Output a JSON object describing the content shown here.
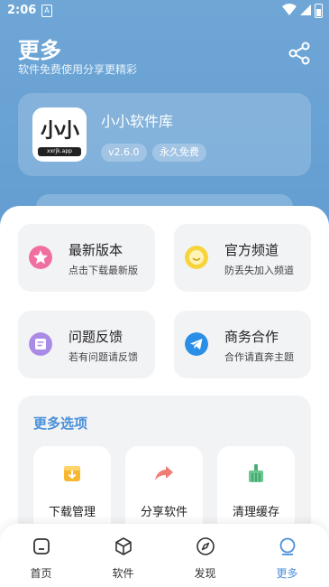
{
  "status_bar": {
    "time": "2:06",
    "sim_letter": "A"
  },
  "header": {
    "title": "更多",
    "subtitle": "软件免费使用分享更精彩"
  },
  "app": {
    "name": "小小软件库",
    "logo_text": "小小",
    "logo_domain": "xxrjk.app",
    "version": "v2.6.0",
    "license": "永久免费"
  },
  "features": [
    {
      "title": "最新版本",
      "desc": "点击下载最新版",
      "icon": "star-icon",
      "color": "#f06ea0"
    },
    {
      "title": "官方频道",
      "desc": "防丢失加入频道",
      "icon": "smile-icon",
      "color": "#f7d43b"
    },
    {
      "title": "问题反馈",
      "desc": "若有问题请反馈",
      "icon": "feedback-icon",
      "color": "#a98be6"
    },
    {
      "title": "商务合作",
      "desc": "合作请直奔主题",
      "icon": "telegram-icon",
      "color": "#2b8ee6"
    }
  ],
  "more_options": {
    "title": "更多选项",
    "items": [
      {
        "label": "下载管理",
        "icon": "download-icon",
        "color": "#f7b731"
      },
      {
        "label": "分享软件",
        "icon": "share-arrow-icon",
        "color": "#f07b72"
      },
      {
        "label": "清理缓存",
        "icon": "broom-icon",
        "color": "#4caf78"
      }
    ]
  },
  "tabs": [
    {
      "label": "首页",
      "icon": "home-icon",
      "active": false
    },
    {
      "label": "软件",
      "icon": "cube-icon",
      "active": false
    },
    {
      "label": "发现",
      "icon": "compass-icon",
      "active": false
    },
    {
      "label": "更多",
      "icon": "more-icon",
      "active": true
    }
  ],
  "colors": {
    "accent": "#4a90d9",
    "header_bg": "#5d99cf"
  }
}
